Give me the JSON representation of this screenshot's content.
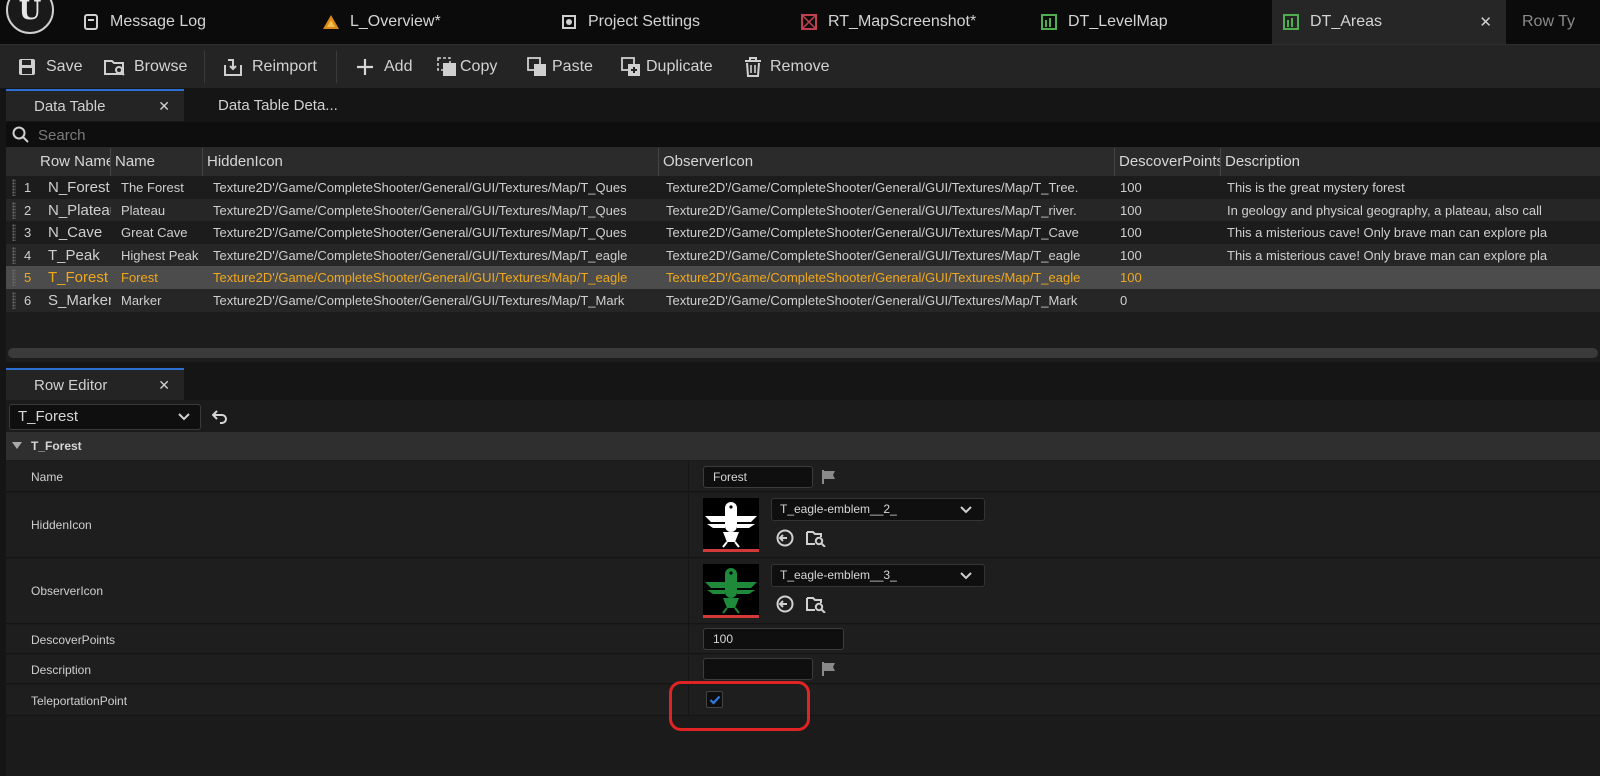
{
  "tabs": [
    {
      "label": "Message Log",
      "icon": "message-log-icon"
    },
    {
      "label": "L_Overview*",
      "icon": "level-icon"
    },
    {
      "label": "Project Settings",
      "icon": "settings-icon"
    },
    {
      "label": "RT_MapScreenshot*",
      "icon": "render-target-icon"
    },
    {
      "label": "DT_LevelMap",
      "icon": "data-table-icon"
    },
    {
      "label": "DT_Areas",
      "icon": "data-table-icon",
      "active": true,
      "close": "✕"
    },
    {
      "label": "Row Ty",
      "icon": ""
    }
  ],
  "toolbar": {
    "save": "Save",
    "browse": "Browse",
    "reimport": "Reimport",
    "add": "Add",
    "copy": "Copy",
    "paste": "Paste",
    "duplicate": "Duplicate",
    "remove": "Remove"
  },
  "panel_tabs": {
    "data_table": "Data Table",
    "data_table_details": "Data Table Deta...",
    "row_editor": "Row Editor",
    "close": "✕"
  },
  "search": {
    "placeholder": "Search"
  },
  "table": {
    "columns": [
      "Row Name",
      "Name",
      "HiddenIcon",
      "ObserverIcon",
      "DescoverPoints",
      "Description"
    ],
    "rows": [
      {
        "index": "1",
        "row_name": "N_Forest",
        "name": "The Forest",
        "hidden": "Texture2D'/Game/CompleteShooter/General/GUI/Textures/Map/T_Ques",
        "observer": "Texture2D'/Game/CompleteShooter/General/GUI/Textures/Map/T_Tree.",
        "points": "100",
        "description": "This is the great mystery forest"
      },
      {
        "index": "2",
        "row_name": "N_Plateau",
        "name": "Plateau",
        "hidden": "Texture2D'/Game/CompleteShooter/General/GUI/Textures/Map/T_Ques",
        "observer": "Texture2D'/Game/CompleteShooter/General/GUI/Textures/Map/T_river.",
        "points": "100",
        "description": "In geology and physical geography, a plateau, also call"
      },
      {
        "index": "3",
        "row_name": "N_Cave",
        "name": "Great Cave",
        "hidden": "Texture2D'/Game/CompleteShooter/General/GUI/Textures/Map/T_Ques",
        "observer": "Texture2D'/Game/CompleteShooter/General/GUI/Textures/Map/T_Cave",
        "points": "100",
        "description": "This a misterious cave! Only brave man can explore pla"
      },
      {
        "index": "4",
        "row_name": "T_Peak",
        "name": "Highest Peak",
        "hidden": "Texture2D'/Game/CompleteShooter/General/GUI/Textures/Map/T_eagle",
        "observer": "Texture2D'/Game/CompleteShooter/General/GUI/Textures/Map/T_eagle",
        "points": "100",
        "description": "This a misterious cave! Only brave man can explore pla"
      },
      {
        "index": "5",
        "row_name": "T_Forest",
        "name": "Forest",
        "hidden": "Texture2D'/Game/CompleteShooter/General/GUI/Textures/Map/T_eagle",
        "observer": "Texture2D'/Game/CompleteShooter/General/GUI/Textures/Map/T_eagle",
        "points": "100",
        "description": "",
        "selected": true
      },
      {
        "index": "6",
        "row_name": "S_Marker",
        "name": "Marker",
        "hidden": "Texture2D'/Game/CompleteShooter/General/GUI/Textures/Map/T_Mark",
        "observer": "Texture2D'/Game/CompleteShooter/General/GUI/Textures/Map/T_Mark",
        "points": "0",
        "description": ""
      }
    ]
  },
  "row_editor": {
    "selected_row": "T_Forest",
    "category": "T_Forest",
    "properties": {
      "name": {
        "label": "Name",
        "value": "Forest"
      },
      "hidden_icon": {
        "label": "HiddenIcon",
        "asset": "T_eagle-emblem__2_"
      },
      "observer_icon": {
        "label": "ObserverIcon",
        "asset": "T_eagle-emblem__3_"
      },
      "descover_points": {
        "label": "DescoverPoints",
        "value": "100"
      },
      "description": {
        "label": "Description",
        "value": ""
      },
      "teleportation_point": {
        "label": "TeleportationPoint",
        "checked": true
      }
    }
  },
  "colors": {
    "selected_text": "#f0a81c",
    "accent_blue": "#2c6fd0",
    "highlight_red": "#e02424",
    "observer_icon_green": "#1e8a3a"
  }
}
